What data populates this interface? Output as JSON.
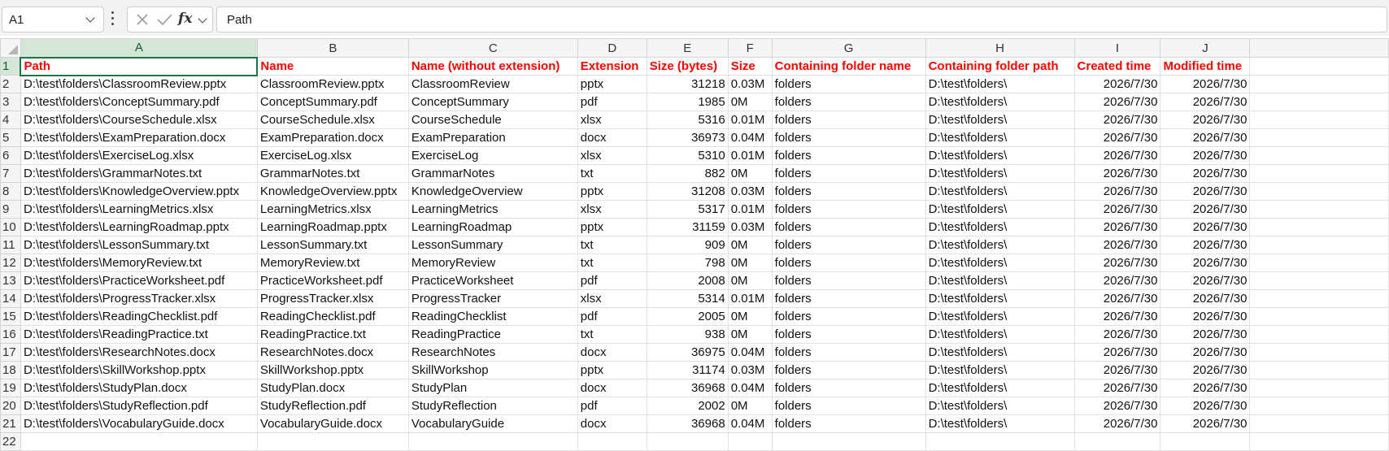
{
  "formula_bar": {
    "name_box": "A1",
    "formula": "Path"
  },
  "columns": [
    "A",
    "B",
    "C",
    "D",
    "E",
    "F",
    "G",
    "H",
    "I",
    "J"
  ],
  "headers": [
    "Path",
    "Name",
    "Name (without extension)",
    "Extension",
    "Size (bytes)",
    "Size",
    "Containing folder name",
    "Containing folder path",
    "Created time",
    "Modified time"
  ],
  "rows": [
    [
      "D:\\test\\folders\\ClassroomReview.pptx",
      "ClassroomReview.pptx",
      "ClassroomReview",
      "pptx",
      "31218",
      "0.03M",
      "folders",
      "D:\\test\\folders\\",
      "2026/7/30",
      "2026/7/30"
    ],
    [
      "D:\\test\\folders\\ConceptSummary.pdf",
      "ConceptSummary.pdf",
      "ConceptSummary",
      "pdf",
      "1985",
      "0M",
      "folders",
      "D:\\test\\folders\\",
      "2026/7/30",
      "2026/7/30"
    ],
    [
      "D:\\test\\folders\\CourseSchedule.xlsx",
      "CourseSchedule.xlsx",
      "CourseSchedule",
      "xlsx",
      "5316",
      "0.01M",
      "folders",
      "D:\\test\\folders\\",
      "2026/7/30",
      "2026/7/30"
    ],
    [
      "D:\\test\\folders\\ExamPreparation.docx",
      "ExamPreparation.docx",
      "ExamPreparation",
      "docx",
      "36973",
      "0.04M",
      "folders",
      "D:\\test\\folders\\",
      "2026/7/30",
      "2026/7/30"
    ],
    [
      "D:\\test\\folders\\ExerciseLog.xlsx",
      "ExerciseLog.xlsx",
      "ExerciseLog",
      "xlsx",
      "5310",
      "0.01M",
      "folders",
      "D:\\test\\folders\\",
      "2026/7/30",
      "2026/7/30"
    ],
    [
      "D:\\test\\folders\\GrammarNotes.txt",
      "GrammarNotes.txt",
      "GrammarNotes",
      "txt",
      "882",
      "0M",
      "folders",
      "D:\\test\\folders\\",
      "2026/7/30",
      "2026/7/30"
    ],
    [
      "D:\\test\\folders\\KnowledgeOverview.pptx",
      "KnowledgeOverview.pptx",
      "KnowledgeOverview",
      "pptx",
      "31208",
      "0.03M",
      "folders",
      "D:\\test\\folders\\",
      "2026/7/30",
      "2026/7/30"
    ],
    [
      "D:\\test\\folders\\LearningMetrics.xlsx",
      "LearningMetrics.xlsx",
      "LearningMetrics",
      "xlsx",
      "5317",
      "0.01M",
      "folders",
      "D:\\test\\folders\\",
      "2026/7/30",
      "2026/7/30"
    ],
    [
      "D:\\test\\folders\\LearningRoadmap.pptx",
      "LearningRoadmap.pptx",
      "LearningRoadmap",
      "pptx",
      "31159",
      "0.03M",
      "folders",
      "D:\\test\\folders\\",
      "2026/7/30",
      "2026/7/30"
    ],
    [
      "D:\\test\\folders\\LessonSummary.txt",
      "LessonSummary.txt",
      "LessonSummary",
      "txt",
      "909",
      "0M",
      "folders",
      "D:\\test\\folders\\",
      "2026/7/30",
      "2026/7/30"
    ],
    [
      "D:\\test\\folders\\MemoryReview.txt",
      "MemoryReview.txt",
      "MemoryReview",
      "txt",
      "798",
      "0M",
      "folders",
      "D:\\test\\folders\\",
      "2026/7/30",
      "2026/7/30"
    ],
    [
      "D:\\test\\folders\\PracticeWorksheet.pdf",
      "PracticeWorksheet.pdf",
      "PracticeWorksheet",
      "pdf",
      "2008",
      "0M",
      "folders",
      "D:\\test\\folders\\",
      "2026/7/30",
      "2026/7/30"
    ],
    [
      "D:\\test\\folders\\ProgressTracker.xlsx",
      "ProgressTracker.xlsx",
      "ProgressTracker",
      "xlsx",
      "5314",
      "0.01M",
      "folders",
      "D:\\test\\folders\\",
      "2026/7/30",
      "2026/7/30"
    ],
    [
      "D:\\test\\folders\\ReadingChecklist.pdf",
      "ReadingChecklist.pdf",
      "ReadingChecklist",
      "pdf",
      "2005",
      "0M",
      "folders",
      "D:\\test\\folders\\",
      "2026/7/30",
      "2026/7/30"
    ],
    [
      "D:\\test\\folders\\ReadingPractice.txt",
      "ReadingPractice.txt",
      "ReadingPractice",
      "txt",
      "938",
      "0M",
      "folders",
      "D:\\test\\folders\\",
      "2026/7/30",
      "2026/7/30"
    ],
    [
      "D:\\test\\folders\\ResearchNotes.docx",
      "ResearchNotes.docx",
      "ResearchNotes",
      "docx",
      "36975",
      "0.04M",
      "folders",
      "D:\\test\\folders\\",
      "2026/7/30",
      "2026/7/30"
    ],
    [
      "D:\\test\\folders\\SkillWorkshop.pptx",
      "SkillWorkshop.pptx",
      "SkillWorkshop",
      "pptx",
      "31174",
      "0.03M",
      "folders",
      "D:\\test\\folders\\",
      "2026/7/30",
      "2026/7/30"
    ],
    [
      "D:\\test\\folders\\StudyPlan.docx",
      "StudyPlan.docx",
      "StudyPlan",
      "docx",
      "36968",
      "0.04M",
      "folders",
      "D:\\test\\folders\\",
      "2026/7/30",
      "2026/7/30"
    ],
    [
      "D:\\test\\folders\\StudyReflection.pdf",
      "StudyReflection.pdf",
      "StudyReflection",
      "pdf",
      "2002",
      "0M",
      "folders",
      "D:\\test\\folders\\",
      "2026/7/30",
      "2026/7/30"
    ],
    [
      "D:\\test\\folders\\VocabularyGuide.docx",
      "VocabularyGuide.docx",
      "VocabularyGuide",
      "docx",
      "36968",
      "0.04M",
      "folders",
      "D:\\test\\folders\\",
      "2026/7/30",
      "2026/7/30"
    ]
  ],
  "numeric_columns": [
    4,
    8,
    9
  ],
  "row_numbers": [
    "1",
    "2",
    "3",
    "4",
    "5",
    "6",
    "7",
    "8",
    "9",
    "10",
    "11",
    "12",
    "13",
    "14",
    "15",
    "16",
    "17",
    "18",
    "19",
    "20",
    "21",
    "22"
  ],
  "colors": {
    "header_text": "#ff0000",
    "selection": "#217346",
    "selection_fill": "#d3e6d7"
  }
}
